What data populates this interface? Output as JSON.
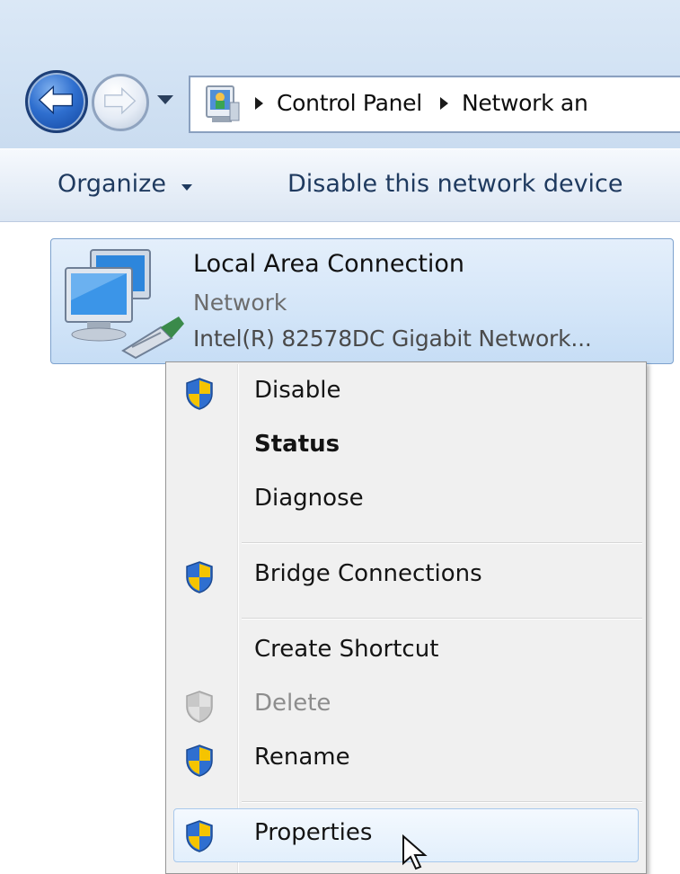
{
  "address_bar": {
    "breadcrumbs": [
      "Control Panel",
      "Network an"
    ],
    "icon": "control-panel-icon"
  },
  "navigation": {
    "back_icon": "back-arrow-icon",
    "forward_icon": "forward-arrow-icon",
    "history_icon": "recent-pages-dropdown-icon"
  },
  "command_bar": {
    "organize_label": "Organize",
    "disable_label": "Disable this network device"
  },
  "network_item": {
    "name": "Local Area Connection",
    "status": "Network",
    "adapter": "Intel(R) 82578DC Gigabit Network...",
    "icon": "network-adapter-icon"
  },
  "context_menu": {
    "items": [
      {
        "label": "Disable",
        "icon": "uac-shield-icon",
        "bold": false,
        "enabled": true
      },
      {
        "label": "Status",
        "icon": "",
        "bold": true,
        "enabled": true
      },
      {
        "label": "Diagnose",
        "icon": "",
        "bold": false,
        "enabled": true
      },
      {
        "label": "Bridge Connections",
        "icon": "uac-shield-icon",
        "bold": false,
        "enabled": true
      },
      {
        "label": "Create Shortcut",
        "icon": "",
        "bold": false,
        "enabled": true
      },
      {
        "label": "Delete",
        "icon": "uac-shield-icon",
        "bold": false,
        "enabled": false
      },
      {
        "label": "Rename",
        "icon": "uac-shield-icon",
        "bold": false,
        "enabled": true
      },
      {
        "label": "Properties",
        "icon": "uac-shield-icon",
        "bold": false,
        "enabled": true,
        "highlighted": true
      }
    ]
  },
  "colors": {
    "titlebar": "#d3e3f4",
    "selection_border": "#7da2ce",
    "menu_background": "#f0f0f0",
    "shield_blue": "#2f6fd0",
    "shield_yellow": "#f5c400"
  }
}
